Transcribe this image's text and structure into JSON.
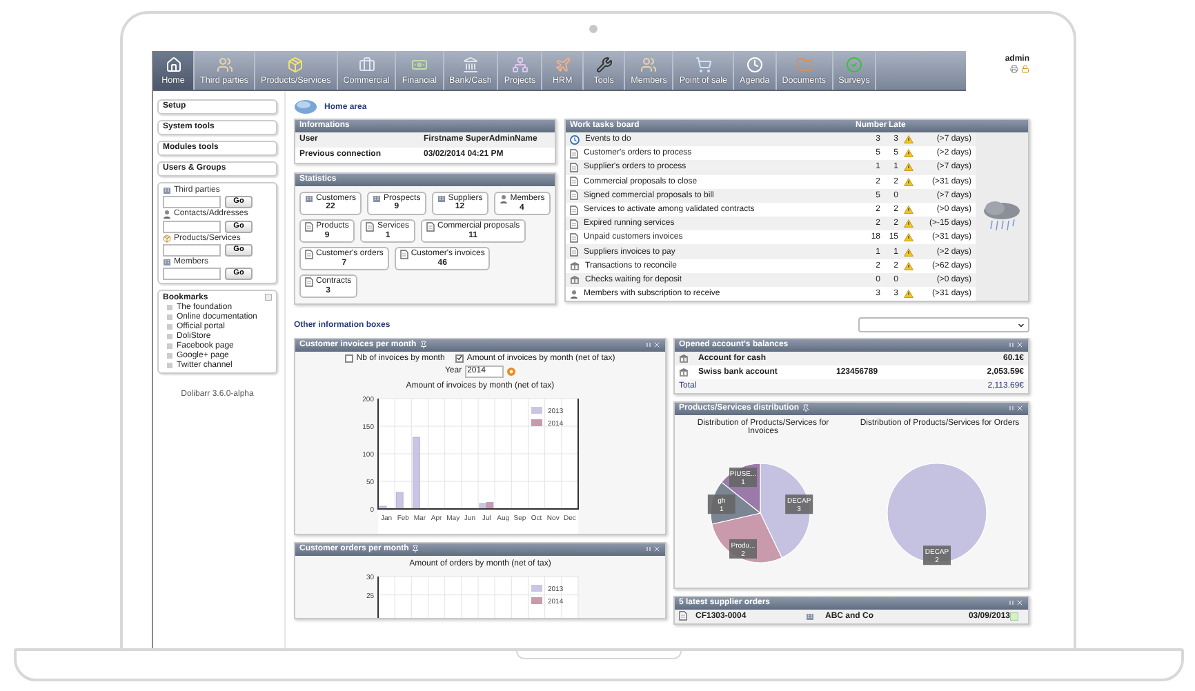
{
  "menu": {
    "items": [
      {
        "label": "Home",
        "selected": true
      },
      {
        "label": "Third parties",
        "selected": false
      },
      {
        "label": "Products/Services",
        "selected": false
      },
      {
        "label": "Commercial",
        "selected": false
      },
      {
        "label": "Financial",
        "selected": false
      },
      {
        "label": "Bank/Cash",
        "selected": false
      },
      {
        "label": "Projects",
        "selected": false
      },
      {
        "label": "HRM",
        "selected": false
      },
      {
        "label": "Tools",
        "selected": false
      },
      {
        "label": "Members",
        "selected": false
      },
      {
        "label": "Point of sale",
        "selected": false
      },
      {
        "label": "Agenda",
        "selected": false
      },
      {
        "label": "Documents",
        "selected": false
      },
      {
        "label": "Surveys",
        "selected": false
      }
    ],
    "user": "admin"
  },
  "sidebar": {
    "nav": [
      "Setup",
      "System tools",
      "Modules tools",
      "Users & Groups"
    ],
    "searches": [
      {
        "label": "Third parties",
        "button": "Go"
      },
      {
        "label": "Contacts/Addresses",
        "button": "Go"
      },
      {
        "label": "Products/Services",
        "button": "Go"
      },
      {
        "label": "Members",
        "button": "Go"
      }
    ],
    "bookmarks": {
      "title": "Bookmarks",
      "items": [
        "The foundation",
        "Online documentation",
        "Official portal",
        "DoliStore",
        "Facebook page",
        "Google+ page",
        "Twitter channel"
      ]
    },
    "version": "Dolibarr 3.6.0-alpha"
  },
  "breadcrumb": "Home area",
  "informations": {
    "title": "Informations",
    "rows": [
      {
        "label": "User",
        "value": "Firstname SuperAdminName"
      },
      {
        "label": "Previous connection",
        "value": "03/02/2014 04:21 PM"
      }
    ]
  },
  "statistics": {
    "title": "Statistics",
    "tiles": [
      {
        "label": "Customers",
        "count": "22"
      },
      {
        "label": "Prospects",
        "count": "9"
      },
      {
        "label": "Suppliers",
        "count": "12"
      },
      {
        "label": "Members",
        "count": "4"
      },
      {
        "label": "Products",
        "count": "9"
      },
      {
        "label": "Services",
        "count": "1"
      },
      {
        "label": "Commercial proposals",
        "count": "11"
      },
      {
        "label": "Customer's orders",
        "count": "7"
      },
      {
        "label": "Customer's invoices",
        "count": "46"
      },
      {
        "label": "Contracts",
        "count": "3"
      }
    ]
  },
  "work_board": {
    "title": "Work tasks board",
    "columns": [
      "Number",
      "Late"
    ],
    "rows": [
      {
        "kind": "event",
        "label": "Events to do",
        "number": "3",
        "late": "3",
        "warning": true,
        "delay": "(>7 days)"
      },
      {
        "kind": "document",
        "label": "Customer's orders to process",
        "number": "5",
        "late": "5",
        "warning": true,
        "delay": "(>2 days)"
      },
      {
        "kind": "document",
        "label": "Supplier's orders to process",
        "number": "1",
        "late": "1",
        "warning": true,
        "delay": "(>7 days)"
      },
      {
        "kind": "document",
        "label": "Commercial proposals to close",
        "number": "2",
        "late": "2",
        "warning": true,
        "delay": "(>31 days)"
      },
      {
        "kind": "document",
        "label": "Signed commercial proposals to bill",
        "number": "5",
        "late": "0",
        "warning": false,
        "delay": "(>7 days)"
      },
      {
        "kind": "document",
        "label": "Services to activate among validated contracts",
        "number": "2",
        "late": "2",
        "warning": true,
        "delay": "(>0 days)"
      },
      {
        "kind": "document",
        "label": "Expired running services",
        "number": "2",
        "late": "2",
        "warning": true,
        "delay": "(>-15 days)"
      },
      {
        "kind": "document",
        "label": "Unpaid customers invoices",
        "number": "18",
        "late": "15",
        "warning": true,
        "delay": "(>31 days)"
      },
      {
        "kind": "document",
        "label": "Suppliers invoices to pay",
        "number": "1",
        "late": "1",
        "warning": true,
        "delay": "(>2 days)"
      },
      {
        "kind": "bank",
        "label": "Transactions to reconcile",
        "number": "2",
        "late": "2",
        "warning": true,
        "delay": "(>62 days)"
      },
      {
        "kind": "bank",
        "label": "Checks waiting for deposit",
        "number": "0",
        "late": "0",
        "warning": false,
        "delay": "(>0 days)"
      },
      {
        "kind": "member",
        "label": "Members with subscription to receive",
        "number": "3",
        "late": "3",
        "warning": true,
        "delay": "(>31 days)"
      }
    ]
  },
  "other_boxes": {
    "title": "Other information boxes"
  },
  "invoices_box": {
    "title": "Customer invoices per month",
    "options": [
      {
        "label": "Nb of invoices by month",
        "checked": false
      },
      {
        "label": "Amount of invoices by month (net of tax)",
        "checked": true
      }
    ],
    "year_label": "Year",
    "year": "2014",
    "chart_data": {
      "type": "bar",
      "title": "Amount of invoices by month (net of tax)",
      "grid": true,
      "legend": true,
      "categories": [
        "Jan",
        "Feb",
        "Mar",
        "Apr",
        "May",
        "Jun",
        "Jul",
        "Aug",
        "Sep",
        "Oct",
        "Nov",
        "Dec"
      ],
      "ylim": [
        0,
        200
      ],
      "yticks": [
        0,
        50,
        100,
        150,
        200
      ],
      "series": [
        {
          "name": "2013",
          "color": "#c9c6e4",
          "values": [
            5,
            30,
            130,
            0,
            0,
            0,
            10,
            0,
            0,
            0,
            0,
            0
          ]
        },
        {
          "name": "2014",
          "color": "#c99aab",
          "values": [
            0,
            0,
            0,
            0,
            0,
            0,
            12,
            0,
            0,
            0,
            0,
            0
          ]
        }
      ]
    }
  },
  "orders_box": {
    "title": "Customer orders per month",
    "chart_data": {
      "type": "bar",
      "title": "Amount of orders by month (net of tax)",
      "grid": true,
      "legend": true,
      "ylim": [
        0,
        30
      ],
      "yticks": [
        25,
        30
      ],
      "series": [
        {
          "name": "2013",
          "color": "#c9c6e4"
        },
        {
          "name": "2014",
          "color": "#c99aab"
        }
      ]
    }
  },
  "balances": {
    "title": "Opened account's balances",
    "rows": [
      {
        "name": "Account for cash",
        "amount": "60.1€"
      },
      {
        "name": "Swiss bank account",
        "number": "123456789",
        "amount": "2,053.59€"
      }
    ],
    "total_label": "Total",
    "total": "2,113.69€"
  },
  "distribution": {
    "title": "Products/Services distribution",
    "charts": [
      {
        "chart_data": {
          "type": "pie",
          "title": "Distribution of Products/Services for Invoices",
          "categories": [
            "DECAP",
            "Produ...",
            "gh",
            "PIUSE..."
          ],
          "values": [
            3,
            2,
            1,
            1
          ],
          "data_labels": true
        }
      },
      {
        "chart_data": {
          "type": "pie",
          "title": "Distribution of Products/Services for Orders",
          "categories": [
            "DECAP"
          ],
          "values": [
            2
          ],
          "data_labels": true
        }
      }
    ]
  },
  "supplier_orders": {
    "title": "5 latest supplier orders",
    "rows": [
      {
        "ref": "CF1303-0004",
        "company": "ABC and Co",
        "date": "03/09/2013"
      }
    ]
  }
}
